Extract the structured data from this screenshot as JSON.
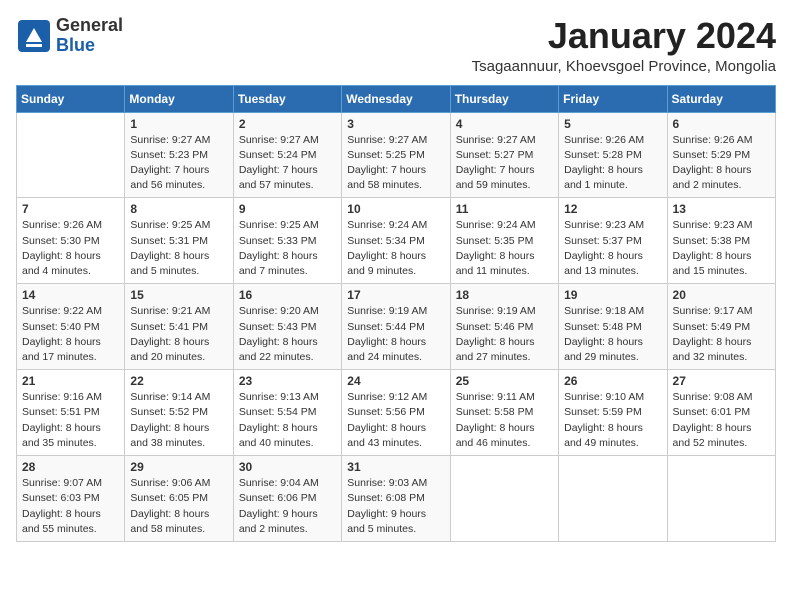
{
  "logo": {
    "general": "General",
    "blue": "Blue"
  },
  "title": "January 2024",
  "subtitle": "Tsagaannuur, Khoevsgoel Province, Mongolia",
  "days_of_week": [
    "Sunday",
    "Monday",
    "Tuesday",
    "Wednesday",
    "Thursday",
    "Friday",
    "Saturday"
  ],
  "weeks": [
    [
      {
        "day": "",
        "detail": ""
      },
      {
        "day": "1",
        "detail": "Sunrise: 9:27 AM\nSunset: 5:23 PM\nDaylight: 7 hours\nand 56 minutes."
      },
      {
        "day": "2",
        "detail": "Sunrise: 9:27 AM\nSunset: 5:24 PM\nDaylight: 7 hours\nand 57 minutes."
      },
      {
        "day": "3",
        "detail": "Sunrise: 9:27 AM\nSunset: 5:25 PM\nDaylight: 7 hours\nand 58 minutes."
      },
      {
        "day": "4",
        "detail": "Sunrise: 9:27 AM\nSunset: 5:27 PM\nDaylight: 7 hours\nand 59 minutes."
      },
      {
        "day": "5",
        "detail": "Sunrise: 9:26 AM\nSunset: 5:28 PM\nDaylight: 8 hours\nand 1 minute."
      },
      {
        "day": "6",
        "detail": "Sunrise: 9:26 AM\nSunset: 5:29 PM\nDaylight: 8 hours\nand 2 minutes."
      }
    ],
    [
      {
        "day": "7",
        "detail": "Sunrise: 9:26 AM\nSunset: 5:30 PM\nDaylight: 8 hours\nand 4 minutes."
      },
      {
        "day": "8",
        "detail": "Sunrise: 9:25 AM\nSunset: 5:31 PM\nDaylight: 8 hours\nand 5 minutes."
      },
      {
        "day": "9",
        "detail": "Sunrise: 9:25 AM\nSunset: 5:33 PM\nDaylight: 8 hours\nand 7 minutes."
      },
      {
        "day": "10",
        "detail": "Sunrise: 9:24 AM\nSunset: 5:34 PM\nDaylight: 8 hours\nand 9 minutes."
      },
      {
        "day": "11",
        "detail": "Sunrise: 9:24 AM\nSunset: 5:35 PM\nDaylight: 8 hours\nand 11 minutes."
      },
      {
        "day": "12",
        "detail": "Sunrise: 9:23 AM\nSunset: 5:37 PM\nDaylight: 8 hours\nand 13 minutes."
      },
      {
        "day": "13",
        "detail": "Sunrise: 9:23 AM\nSunset: 5:38 PM\nDaylight: 8 hours\nand 15 minutes."
      }
    ],
    [
      {
        "day": "14",
        "detail": "Sunrise: 9:22 AM\nSunset: 5:40 PM\nDaylight: 8 hours\nand 17 minutes."
      },
      {
        "day": "15",
        "detail": "Sunrise: 9:21 AM\nSunset: 5:41 PM\nDaylight: 8 hours\nand 20 minutes."
      },
      {
        "day": "16",
        "detail": "Sunrise: 9:20 AM\nSunset: 5:43 PM\nDaylight: 8 hours\nand 22 minutes."
      },
      {
        "day": "17",
        "detail": "Sunrise: 9:19 AM\nSunset: 5:44 PM\nDaylight: 8 hours\nand 24 minutes."
      },
      {
        "day": "18",
        "detail": "Sunrise: 9:19 AM\nSunset: 5:46 PM\nDaylight: 8 hours\nand 27 minutes."
      },
      {
        "day": "19",
        "detail": "Sunrise: 9:18 AM\nSunset: 5:48 PM\nDaylight: 8 hours\nand 29 minutes."
      },
      {
        "day": "20",
        "detail": "Sunrise: 9:17 AM\nSunset: 5:49 PM\nDaylight: 8 hours\nand 32 minutes."
      }
    ],
    [
      {
        "day": "21",
        "detail": "Sunrise: 9:16 AM\nSunset: 5:51 PM\nDaylight: 8 hours\nand 35 minutes."
      },
      {
        "day": "22",
        "detail": "Sunrise: 9:14 AM\nSunset: 5:52 PM\nDaylight: 8 hours\nand 38 minutes."
      },
      {
        "day": "23",
        "detail": "Sunrise: 9:13 AM\nSunset: 5:54 PM\nDaylight: 8 hours\nand 40 minutes."
      },
      {
        "day": "24",
        "detail": "Sunrise: 9:12 AM\nSunset: 5:56 PM\nDaylight: 8 hours\nand 43 minutes."
      },
      {
        "day": "25",
        "detail": "Sunrise: 9:11 AM\nSunset: 5:58 PM\nDaylight: 8 hours\nand 46 minutes."
      },
      {
        "day": "26",
        "detail": "Sunrise: 9:10 AM\nSunset: 5:59 PM\nDaylight: 8 hours\nand 49 minutes."
      },
      {
        "day": "27",
        "detail": "Sunrise: 9:08 AM\nSunset: 6:01 PM\nDaylight: 8 hours\nand 52 minutes."
      }
    ],
    [
      {
        "day": "28",
        "detail": "Sunrise: 9:07 AM\nSunset: 6:03 PM\nDaylight: 8 hours\nand 55 minutes."
      },
      {
        "day": "29",
        "detail": "Sunrise: 9:06 AM\nSunset: 6:05 PM\nDaylight: 8 hours\nand 58 minutes."
      },
      {
        "day": "30",
        "detail": "Sunrise: 9:04 AM\nSunset: 6:06 PM\nDaylight: 9 hours\nand 2 minutes."
      },
      {
        "day": "31",
        "detail": "Sunrise: 9:03 AM\nSunset: 6:08 PM\nDaylight: 9 hours\nand 5 minutes."
      },
      {
        "day": "",
        "detail": ""
      },
      {
        "day": "",
        "detail": ""
      },
      {
        "day": "",
        "detail": ""
      }
    ]
  ]
}
